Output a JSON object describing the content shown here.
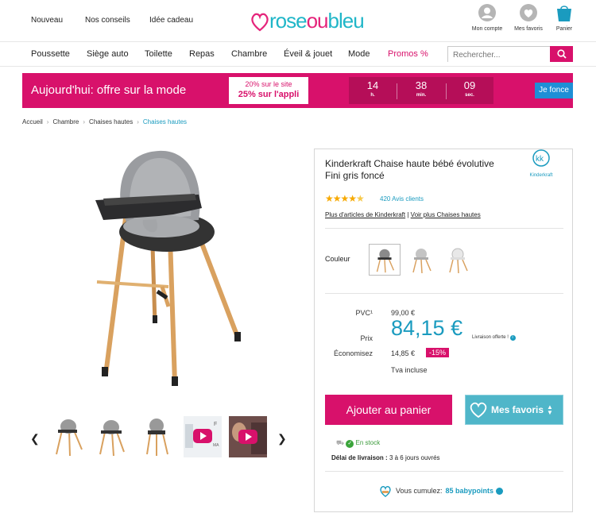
{
  "header": {
    "links": [
      "Nouveau",
      "Nos conseils",
      "Idée cadeau"
    ],
    "logo_text_1": "rose",
    "logo_text_2": "ou",
    "logo_text_3": "bleu",
    "account_label": "Mon compte",
    "favorites_label": "Mes favoris",
    "cart_label": "Panier"
  },
  "nav": {
    "items": [
      "Poussette",
      "Siège auto",
      "Toilette",
      "Repas",
      "Chambre",
      "Éveil & jouet",
      "Mode",
      "Promos %"
    ],
    "search_placeholder": "Rechercher..."
  },
  "banner": {
    "title": "Aujourd'hui: offre sur la mode",
    "offer_line1": "20% sur le site",
    "offer_line2": "25% sur l'appli",
    "timer": [
      {
        "value": "14",
        "unit": "h."
      },
      {
        "value": "38",
        "unit": "min."
      },
      {
        "value": "09",
        "unit": "sec."
      }
    ],
    "cta": "Je fonce"
  },
  "breadcrumb": [
    "Accueil",
    "Chambre",
    "Chaises hautes",
    "Chaises hautes"
  ],
  "product": {
    "title": "Kinderkraft Chaise haute bébé évolutive Fini gris foncé",
    "brand": "Kinderkraft",
    "rating": 4.5,
    "reviews": "420 Avis clients",
    "link1": "Plus d'articles de Kinderkraft",
    "link2": "Voir plus Chaises hautes",
    "color_label": "Couleur",
    "pvc_label": "PVC¹",
    "pvc_value": "99,00 €",
    "price_label": "Prix",
    "price_value": "84,15 €",
    "delivery_note": "Livraison offerte !",
    "savings_label": "Économisez",
    "savings_value": "14,85 €",
    "discount": "-15%",
    "tax_note": "Tva incluse",
    "add_to_cart": "Ajouter au panier",
    "favorites_button": "Mes favoris",
    "stock": "En stock",
    "delivery_label": "Délai de livraison :",
    "delivery_value": "3 à 6 jours ouvrés",
    "babypoints_prefix": "Vous cumulez:",
    "babypoints_value": "85 babypoints"
  },
  "colors": {
    "brand_pink": "#d8116b",
    "brand_teal": "#1a9bbf",
    "fav_button": "#4fb6c9"
  }
}
